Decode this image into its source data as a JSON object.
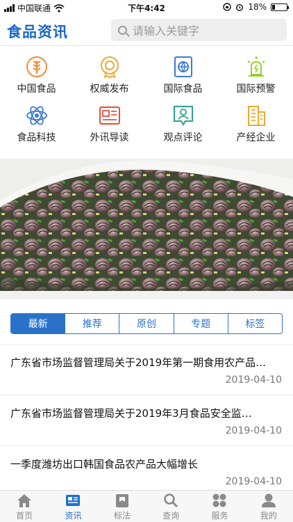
{
  "status_bar": {
    "carrier": "中国联通",
    "time": "下午4:42",
    "battery": "18%",
    "battery_level": 0.18
  },
  "header": {
    "logo": "食品资讯",
    "search_placeholder": "请输入关键字"
  },
  "categories": [
    {
      "label": "中国食品",
      "icon": "wheat-icon",
      "color": "#f08a3c"
    },
    {
      "label": "权威发布",
      "icon": "medal-icon",
      "color": "#f0a830"
    },
    {
      "label": "国际食品",
      "icon": "globe-doc-icon",
      "color": "#3d7ad6"
    },
    {
      "label": "国际预警",
      "icon": "alarm-icon",
      "color": "#9acd32"
    },
    {
      "label": "食品科技",
      "icon": "atom-icon",
      "color": "#3d7ad6"
    },
    {
      "label": "外讯导读",
      "icon": "news-board-icon",
      "color": "#e2503c"
    },
    {
      "label": "观点评论",
      "icon": "user-comment-icon",
      "color": "#2aa38a"
    },
    {
      "label": "产经企业",
      "icon": "building-icon",
      "color": "#f0a830"
    }
  ],
  "tabs": [
    {
      "label": "最新",
      "active": true
    },
    {
      "label": "推荐",
      "active": false
    },
    {
      "label": "原创",
      "active": false
    },
    {
      "label": "专题",
      "active": false
    },
    {
      "label": "标签",
      "active": false
    }
  ],
  "news": [
    {
      "title": "广东省市场监督管理局关于2019年第一期食用农产品…",
      "date": "2019-04-10"
    },
    {
      "title": "广东省市场监督管理局关于2019年3月食品安全监…",
      "date": "2019-04-10"
    },
    {
      "title": "一季度潍坊出口韩国食品农产品大幅增长",
      "date": "2019-04-10"
    }
  ],
  "bottom_nav": [
    {
      "label": "首页",
      "icon": "home-icon",
      "active": false
    },
    {
      "label": "资讯",
      "icon": "news-icon",
      "active": true
    },
    {
      "label": "标法",
      "icon": "standard-icon",
      "active": false
    },
    {
      "label": "查询",
      "icon": "search-icon",
      "active": false
    },
    {
      "label": "服务",
      "icon": "service-icon",
      "active": false
    },
    {
      "label": "我的",
      "icon": "profile-icon",
      "active": false
    }
  ]
}
